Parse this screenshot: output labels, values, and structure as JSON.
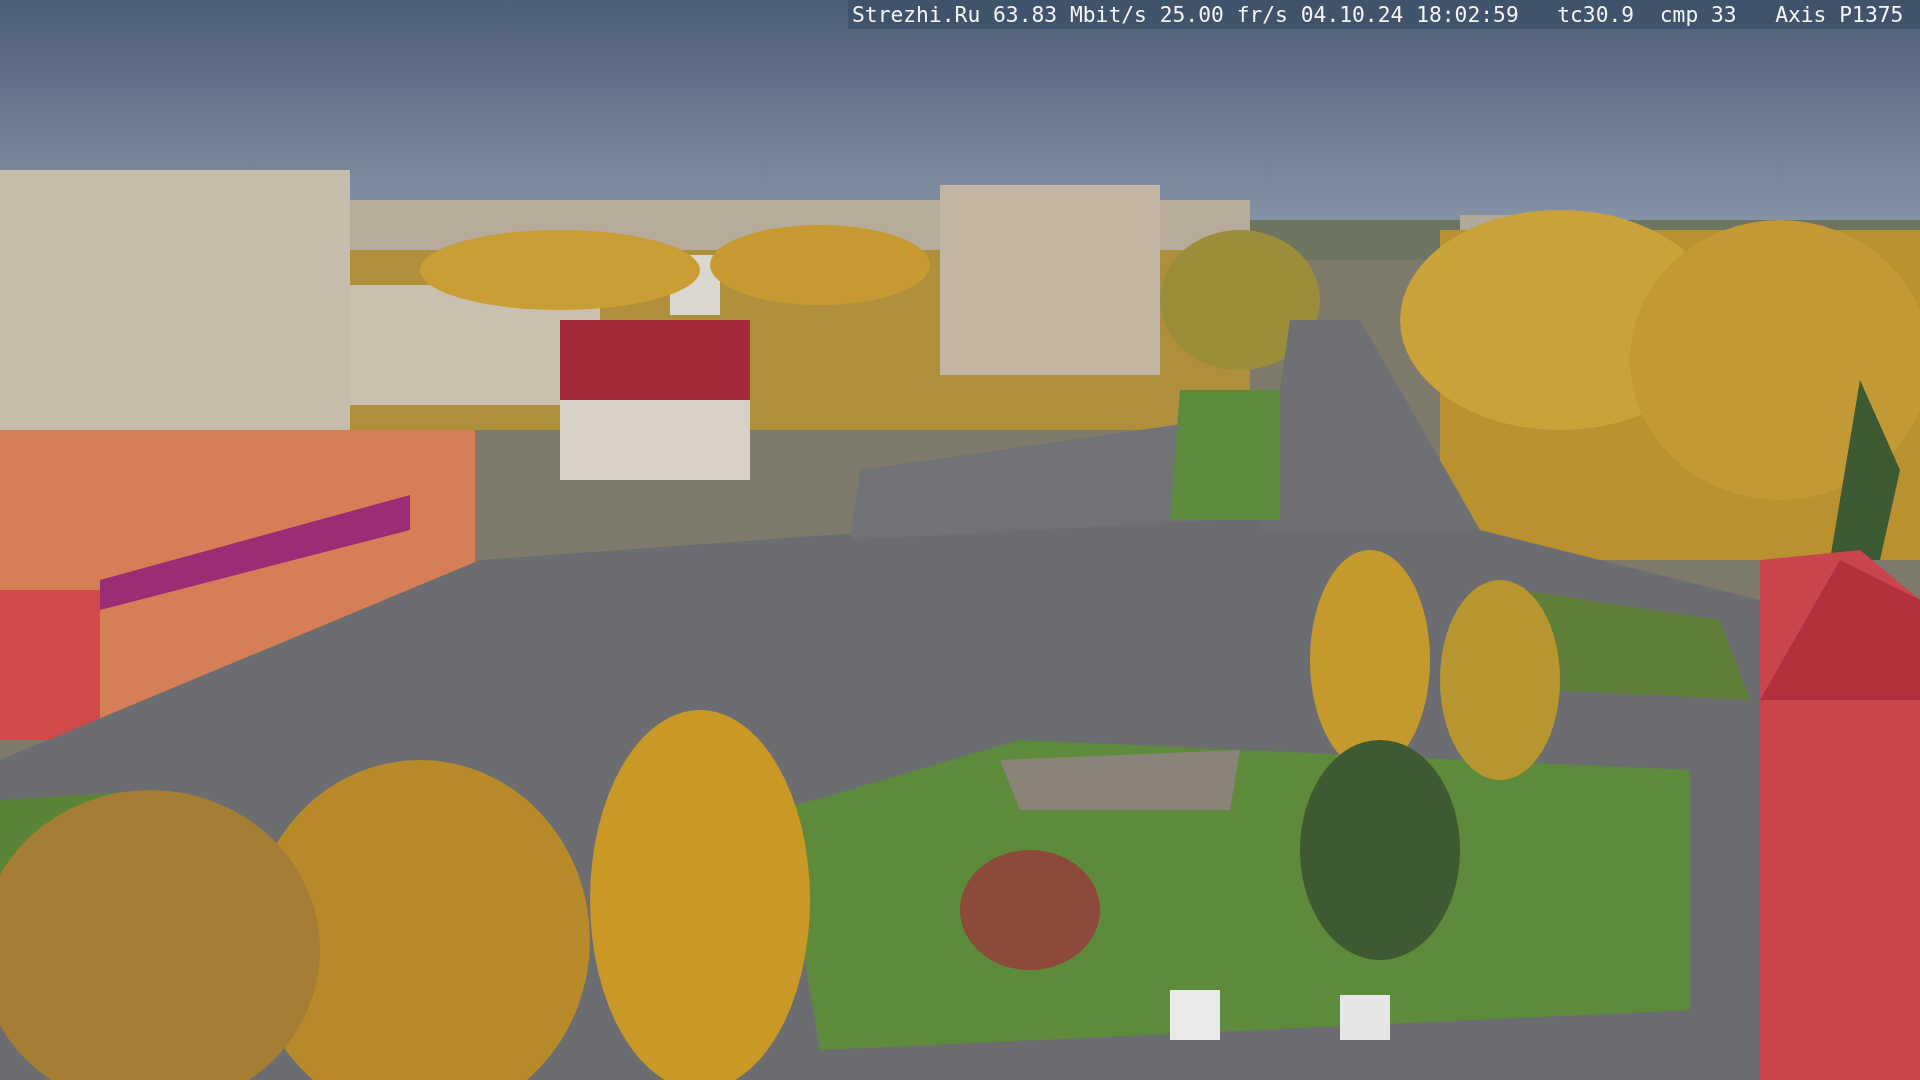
{
  "camera_feed": {
    "overlay": {
      "site": "Strezhi.Ru",
      "bitrate": "63.83 Mbit/s",
      "frame_rate": "25.00 fr/s",
      "date": "04.10.24",
      "time": "18:02:59",
      "tc": "tc30.9",
      "cmp": "cmp 33",
      "camera_model": "Axis P1375"
    }
  }
}
